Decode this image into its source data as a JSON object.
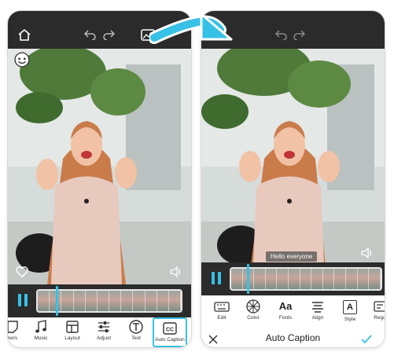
{
  "left": {
    "toolbar": {
      "items": [
        {
          "label": "Stickers",
          "icon": "sticker-icon"
        },
        {
          "label": "Music",
          "icon": "music-note-icon"
        },
        {
          "label": "Layout",
          "icon": "layout-icon"
        },
        {
          "label": "Adjust",
          "icon": "sliders-icon"
        },
        {
          "label": "Text",
          "icon": "text-icon"
        },
        {
          "label": "Auto Caption",
          "icon": "cc-icon"
        }
      ],
      "visible_labels": [
        "kers",
        "Music",
        "Layout",
        "Adjust",
        "Text",
        "Auto Caption"
      ],
      "selected": "Auto Caption"
    },
    "icons": [
      "home-icon",
      "undo-icon",
      "redo-icon",
      "image-icon",
      "face-emoji-icon",
      "heart-icon",
      "volume-icon"
    ]
  },
  "right": {
    "caption_text": "Hello everyone",
    "tools": [
      {
        "label": "Edit",
        "icon": "keyboard-icon"
      },
      {
        "label": "Color",
        "icon": "color-wheel-icon"
      },
      {
        "label": "Fonts",
        "icon": "fonts-icon",
        "glyph": "Aa"
      },
      {
        "label": "Align",
        "icon": "align-icon"
      },
      {
        "label": "Style",
        "icon": "style-icon",
        "glyph": "A"
      },
      {
        "label": "Regu",
        "icon": "regular-icon"
      }
    ],
    "title": "Auto Caption",
    "icons": [
      "close-icon",
      "checkmark-icon",
      "undo-icon",
      "redo-icon",
      "volume-icon"
    ]
  },
  "colors": {
    "accent": "#37c1e6",
    "bar": "#2b2b2b",
    "arrow": "#37c1e6"
  }
}
